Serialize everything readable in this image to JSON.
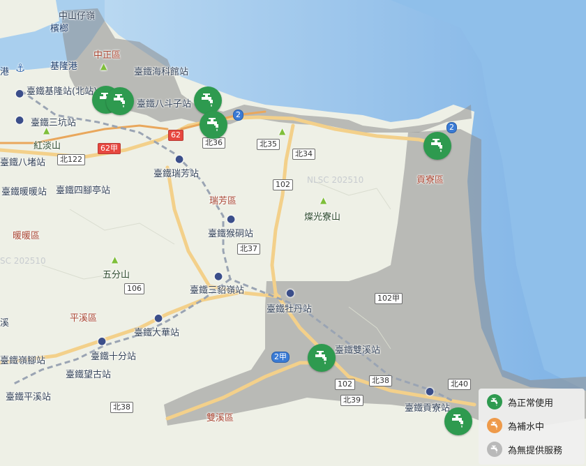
{
  "colors": {
    "normal": "#2e9a4f",
    "refilling": "#ee9a4a",
    "no_service": "#b9b9b9",
    "sea": "#a9cfee",
    "land": "#eef0e6"
  },
  "icons": {
    "marker": "water-faucet-icon",
    "station": "train-station-icon",
    "mountain": "mountain-icon",
    "harbor": "anchor-icon"
  },
  "districts": [
    "中正區",
    "瑞芳區",
    "暖暖區",
    "平溪區",
    "雙溪區",
    "貢寮區"
  ],
  "stations": [
    "臺鐵海科館站",
    "臺鐵基隆站(北站)",
    "臺鐵三坑站",
    "臺鐵八斗子站",
    "臺鐵八堵站",
    "臺鐵暖暖站",
    "臺鐵四腳亭站",
    "臺鐵瑞芳站",
    "臺鐵猴硐站",
    "臺鐵三貂嶺站",
    "臺鐵牡丹站",
    "臺鐵雙溪站",
    "臺鐵大華站",
    "臺鐵十分站",
    "臺鐵嶺腳站",
    "臺鐵望古站",
    "臺鐵平溪站",
    "臺鐵貢寮站"
  ],
  "places": [
    "中山仔嶺",
    "檳榔",
    "基隆港",
    "港",
    "紅淡山",
    "燦光寮山",
    "五分山",
    "溪"
  ],
  "roads": [
    "62",
    "北122",
    "北36",
    "北35",
    "北34",
    "102",
    "北37",
    "106",
    "102甲",
    "102",
    "北38",
    "北39",
    "北40",
    "北38",
    "2",
    "2",
    "2甲",
    "62甲"
  ],
  "watermarks": [
    "NLSC 202510",
    "SC 202510"
  ],
  "legend": {
    "items": [
      {
        "label": "為正常使用"
      },
      {
        "label": "為補水中"
      },
      {
        "label": "為無提供服務"
      }
    ]
  }
}
